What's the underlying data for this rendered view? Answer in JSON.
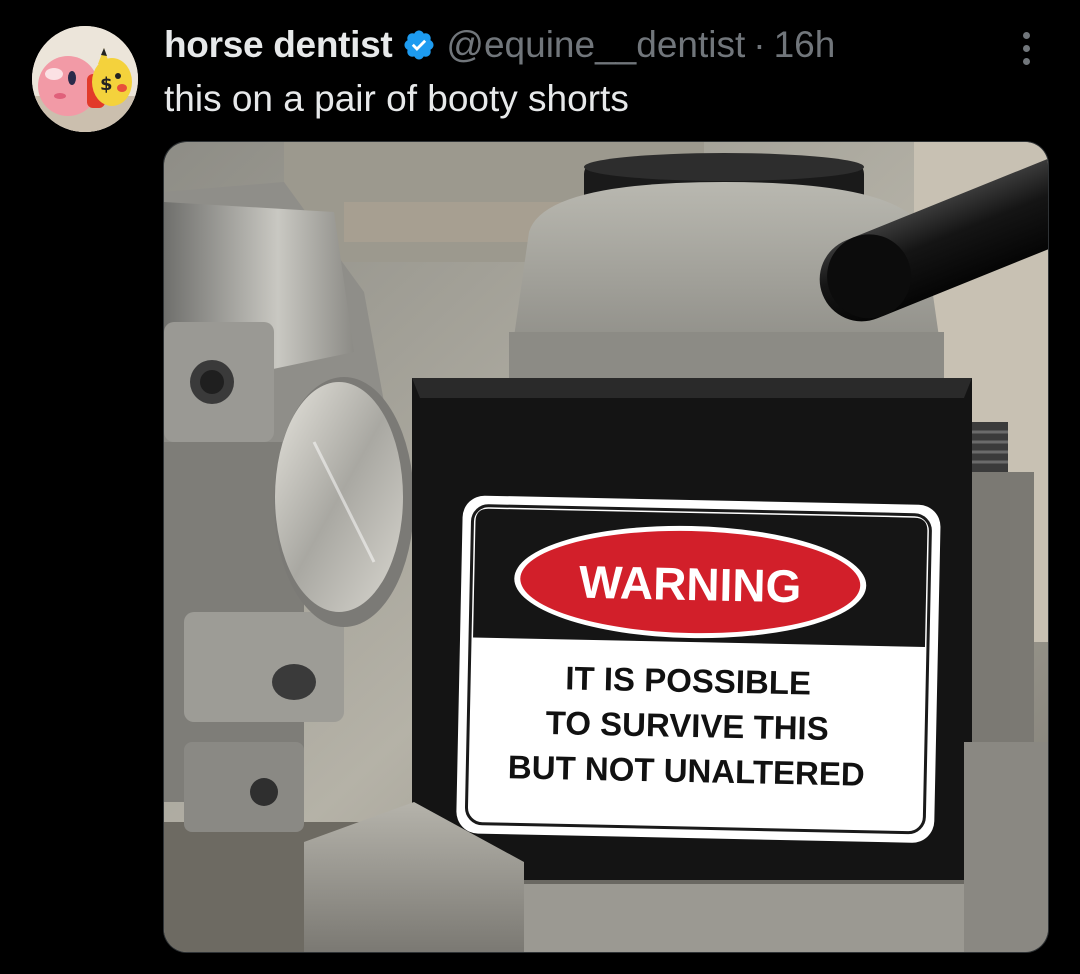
{
  "tweet": {
    "display_name": "horse dentist",
    "handle": "@equine__dentist",
    "separator": "·",
    "time": "16h",
    "text": "this on a pair of booty shorts"
  },
  "media": {
    "sign": {
      "header": "WARNING",
      "line1": "IT IS POSSIBLE",
      "line2": "TO SURVIVE THIS",
      "line3": "BUT NOT UNALTERED"
    }
  },
  "icons": {
    "verified": "verified-badge-icon",
    "more": "more-options-icon"
  },
  "colors": {
    "background": "#000000",
    "text_primary": "#e7e9ea",
    "text_secondary": "#71767b",
    "verified_blue": "#1d9bf0",
    "warning_red": "#d21f2a"
  }
}
